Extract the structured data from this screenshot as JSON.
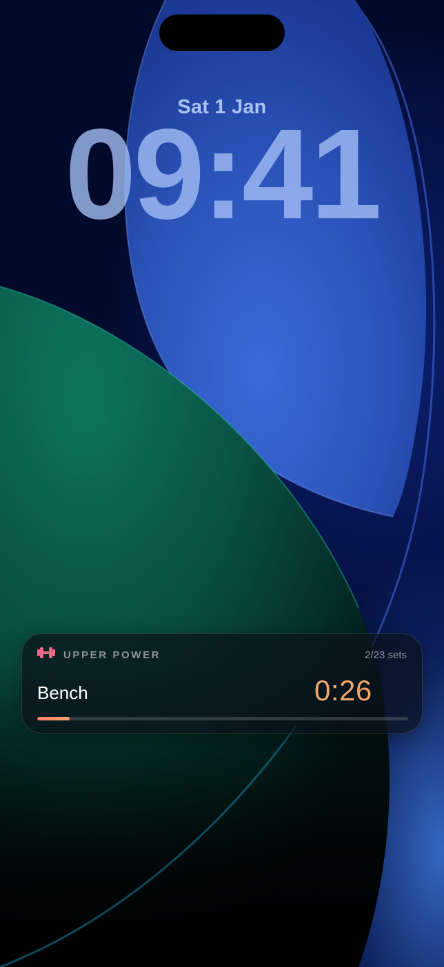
{
  "lock_screen": {
    "date": "Sat 1 Jan",
    "time": "09:41"
  },
  "live_activity": {
    "icon": "dumbbell-icon",
    "workout_title": "UPPER POWER",
    "sets": "2/23 sets",
    "exercise": "Bench",
    "timer": "0:26",
    "progress_fraction": 0.087,
    "accent_color": "#f2a66a"
  }
}
